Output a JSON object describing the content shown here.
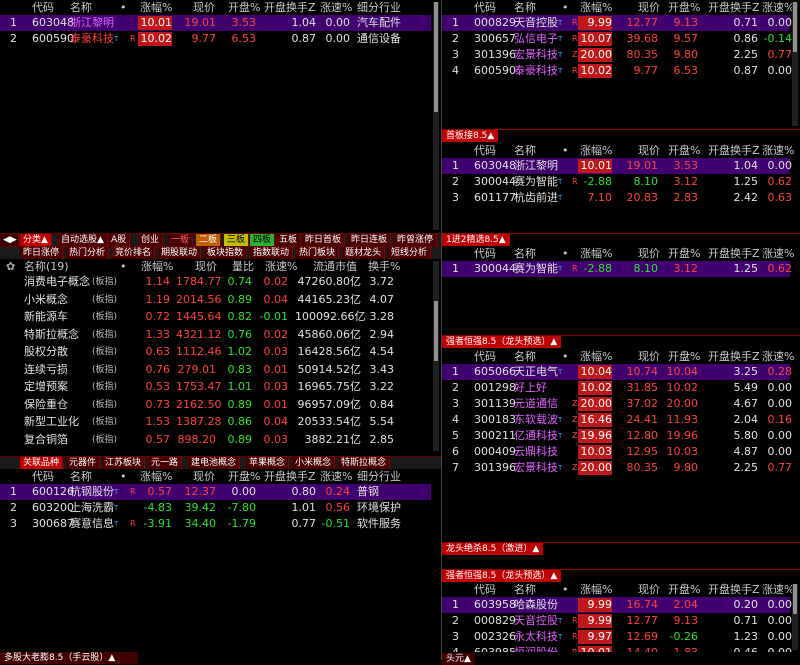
{
  "cols": {
    "code": "代码",
    "name": "名称",
    "pct": "涨幅%",
    "price": "现价",
    "open": "开盘%",
    "turnover": "开盘换手Z",
    "speed": "涨速%",
    "industry": "细分行业",
    "dot": "•"
  },
  "tl": {
    "rows": [
      {
        "n": "1",
        "code": "603048",
        "name": "浙江黎明",
        "pct": "10.01",
        "price": "19.01",
        "open": "3.53",
        "to": "1.04",
        "sp": "0.00",
        "ind": "汽车配件"
      },
      {
        "n": "2",
        "code": "600590",
        "name": "泰豪科技",
        "sup": "T",
        "tag": "R",
        "pct": "10.02",
        "price": "9.77",
        "open": "6.53",
        "to": "0.87",
        "sp": "0.00",
        "ind": "通信设备"
      }
    ]
  },
  "tabs1": [
    "分类▲",
    "自动选股▲",
    "A股",
    "创业",
    "一板",
    "二板",
    "三板",
    "四板",
    "五板",
    "昨日首板",
    "昨日连板",
    "昨曾涨停"
  ],
  "tabs2": [
    "昨日涨停",
    "热门分析",
    "竞价排名",
    "期股联动",
    "板块指数",
    "指数联动",
    "热门板块",
    "题材龙头",
    "短线分析"
  ],
  "sector": {
    "hdr": {
      "name": "名称(19)",
      "dot": "•",
      "pct": "涨幅%",
      "price": "现价",
      "vr": "量比",
      "sp": "涨速%",
      "mv": "流通市值",
      "to": "换手%"
    },
    "rows": [
      {
        "name": "消费电子概念",
        "tag": "(板指)",
        "pct": "1.14",
        "price": "1784.77",
        "vr": "0.74",
        "sp": "0.02",
        "mv": "47260.80亿",
        "to": "3.72"
      },
      {
        "name": "小米概念",
        "tag": "(板指)",
        "pct": "1.19",
        "price": "2014.56",
        "vr": "0.89",
        "sp": "0.04",
        "mv": "44165.23亿",
        "to": "4.07"
      },
      {
        "name": "新能源车",
        "tag": "(板指)",
        "pct": "0.72",
        "price": "1445.64",
        "vr": "0.82",
        "sp": "-0.01",
        "mv": "100092.66亿",
        "to": "3.28"
      },
      {
        "name": "特斯拉概念",
        "tag": "(板指)",
        "pct": "1.33",
        "price": "4321.12",
        "vr": "0.76",
        "sp": "0.02",
        "mv": "45860.06亿",
        "to": "2.94"
      },
      {
        "name": "股权分散",
        "tag": "(板指)",
        "pct": "0.63",
        "price": "1112.46",
        "vr": "1.02",
        "sp": "0.03",
        "mv": "16428.56亿",
        "to": "4.54"
      },
      {
        "name": "连续亏损",
        "tag": "(板指)",
        "pct": "0.76",
        "price": "279.01",
        "vr": "0.83",
        "sp": "0.01",
        "mv": "50914.52亿",
        "to": "3.43"
      },
      {
        "name": "定增预案",
        "tag": "(板指)",
        "pct": "0.53",
        "price": "1753.47",
        "vr": "1.01",
        "sp": "0.03",
        "mv": "16965.75亿",
        "to": "3.22"
      },
      {
        "name": "保险重仓",
        "tag": "(板指)",
        "pct": "0.73",
        "price": "2162.50",
        "vr": "0.89",
        "sp": "0.01",
        "mv": "96957.09亿",
        "to": "0.84"
      },
      {
        "name": "新型工业化",
        "tag": "(板指)",
        "pct": "1.53",
        "price": "1387.28",
        "vr": "0.86",
        "sp": "0.04",
        "mv": "20533.54亿",
        "to": "5.54"
      },
      {
        "name": "复合铜箔",
        "tag": "(板指)",
        "pct": "0.57",
        "price": "898.20",
        "vr": "0.89",
        "sp": "0.03",
        "mv": "3882.21亿",
        "to": "2.85"
      }
    ]
  },
  "tabs3": [
    "关联品种",
    "元器件",
    "江苏板块",
    "元一路",
    "建电池概念",
    "苹果概念",
    "小米概念",
    "特斯拉概念"
  ],
  "assoc": {
    "rows": [
      {
        "n": "1",
        "code": "600126",
        "name": "杭钢股份",
        "sup": "T",
        "tag": "R",
        "pct": "0.57",
        "price": "12.37",
        "open": "0.00",
        "to": "0.80",
        "sp": "0.24",
        "ind": "普钢"
      },
      {
        "n": "2",
        "code": "603200",
        "name": "上海洗霸",
        "sup": "T",
        "tag": "",
        "pct": "-4.83",
        "price": "39.42",
        "open": "-7.80",
        "to": "1.01",
        "sp": "0.56",
        "ind": "环境保护"
      },
      {
        "n": "3",
        "code": "300687",
        "name": "赛意信息",
        "sup": "T",
        "tag": "R",
        "pct": "-3.91",
        "price": "34.40",
        "open": "-1.79",
        "to": "0.77",
        "sp": "-0.51",
        "ind": "软件服务"
      }
    ]
  },
  "bottomLeftTitle": "多股大老膨8.5（手云股）▲",
  "tr": {
    "rows": [
      {
        "n": "1",
        "code": "000829",
        "name": "天音控股",
        "sup": "T",
        "tag": "R",
        "pct": "9.99",
        "price": "12.77",
        "open": "9.13",
        "to": "0.71",
        "sp": "0.00"
      },
      {
        "n": "2",
        "code": "300657",
        "name": "弘信电子",
        "sup": "T",
        "tag": "R",
        "pct": "10.07",
        "price": "39.68",
        "open": "9.57",
        "to": "0.86",
        "sp": "-0.14"
      },
      {
        "n": "3",
        "code": "301396",
        "name": "宏景科技",
        "sup": "T",
        "tag": "Z",
        "pct": "20.00",
        "price": "80.35",
        "open": "9.80",
        "to": "2.25",
        "sp": "0.77"
      },
      {
        "n": "4",
        "code": "600590",
        "name": "泰豪科技",
        "sup": "T",
        "tag": "R",
        "pct": "10.02",
        "price": "9.77",
        "open": "6.53",
        "to": "0.87",
        "sp": "0.00"
      }
    ]
  },
  "p2": {
    "title": "首板接8.5▲",
    "rows": [
      {
        "n": "1",
        "code": "603048",
        "name": "浙江黎明",
        "tag": "",
        "pct": "10.01",
        "price": "19.01",
        "open": "3.53",
        "to": "1.04",
        "sp": "0.00"
      },
      {
        "n": "2",
        "code": "300044",
        "name": "赛为智能",
        "sup": "T",
        "tag": "R",
        "pct": "-2.88",
        "price": "8.10",
        "open": "3.12",
        "to": "1.25",
        "sp": "0.62"
      },
      {
        "n": "3",
        "code": "601177",
        "name": "杭齿前进",
        "sup": "T",
        "tag": "",
        "pct": "7.10",
        "price": "20.83",
        "open": "2.83",
        "to": "2.42",
        "sp": "0.63"
      }
    ]
  },
  "p3": {
    "title": "1进2精选8.5▲",
    "rows": [
      {
        "n": "1",
        "code": "300044",
        "name": "赛为智能",
        "sup": "T",
        "tag": "R",
        "pct": "-2.88",
        "price": "8.10",
        "open": "3.12",
        "to": "1.25",
        "sp": "0.62"
      }
    ]
  },
  "p4": {
    "title": "强者恒强8.5（龙头预选）▲",
    "rows": [
      {
        "n": "1",
        "code": "605066",
        "name": "天正电气",
        "sup": "T",
        "tag": "",
        "pct": "10.04",
        "price": "10.74",
        "open": "10.04",
        "to": "3.25",
        "sp": "0.28"
      },
      {
        "n": "2",
        "code": "001298",
        "name": "好上好",
        "sup": "",
        "tag": "",
        "pct": "10.02",
        "price": "31.85",
        "open": "10.02",
        "to": "5.49",
        "sp": "0.00"
      },
      {
        "n": "3",
        "code": "301139",
        "name": "元道通信",
        "sup": "",
        "tag": "Z",
        "pct": "20.00",
        "price": "37.02",
        "open": "20.00",
        "to": "4.67",
        "sp": "0.00"
      },
      {
        "n": "4",
        "code": "300183",
        "name": "东软载波",
        "sup": "T",
        "tag": "Z",
        "pct": "16.46",
        "price": "24.41",
        "open": "11.93",
        "to": "2.04",
        "sp": "0.16"
      },
      {
        "n": "5",
        "code": "300211",
        "name": "亿通科技",
        "sup": "T",
        "tag": "Z",
        "pct": "19.96",
        "price": "12.80",
        "open": "19.96",
        "to": "5.80",
        "sp": "0.00"
      },
      {
        "n": "6",
        "code": "000409",
        "name": "云鼎科技",
        "sup": "",
        "tag": "",
        "pct": "10.03",
        "price": "12.95",
        "open": "10.03",
        "to": "4.87",
        "sp": "0.00"
      },
      {
        "n": "7",
        "code": "301396",
        "name": "宏景科技",
        "sup": "T",
        "tag": "Z",
        "pct": "20.00",
        "price": "80.35",
        "open": "9.80",
        "to": "2.25",
        "sp": "0.77"
      }
    ]
  },
  "p5": {
    "title": "龙头绝杀8.5（激进）▲"
  },
  "p6": {
    "title": "强者恒强8.5（龙头预选）▲",
    "rows": [
      {
        "n": "1",
        "code": "603958",
        "name": "哈森股份",
        "sup": "",
        "tag": "",
        "pct": "9.99",
        "price": "16.74",
        "open": "2.04",
        "to": "0.20",
        "sp": "0.00"
      },
      {
        "n": "2",
        "code": "000829",
        "name": "天音控股",
        "sup": "T",
        "tag": "R",
        "pct": "9.99",
        "price": "12.77",
        "open": "9.13",
        "to": "0.71",
        "sp": "0.00"
      },
      {
        "n": "3",
        "code": "002326",
        "name": "永太科技",
        "sup": "T",
        "tag": "R",
        "pct": "9.97",
        "price": "12.69",
        "open": "-0.26",
        "to": "1.23",
        "sp": "0.00"
      },
      {
        "n": "4",
        "code": "603985",
        "name": "恒润股份",
        "sup": "",
        "tag": "R",
        "pct": "10.01",
        "price": "14.40",
        "open": "1.83",
        "to": "0.46",
        "sp": "0.00"
      }
    ]
  },
  "bottomRightTitle": "头元▲"
}
